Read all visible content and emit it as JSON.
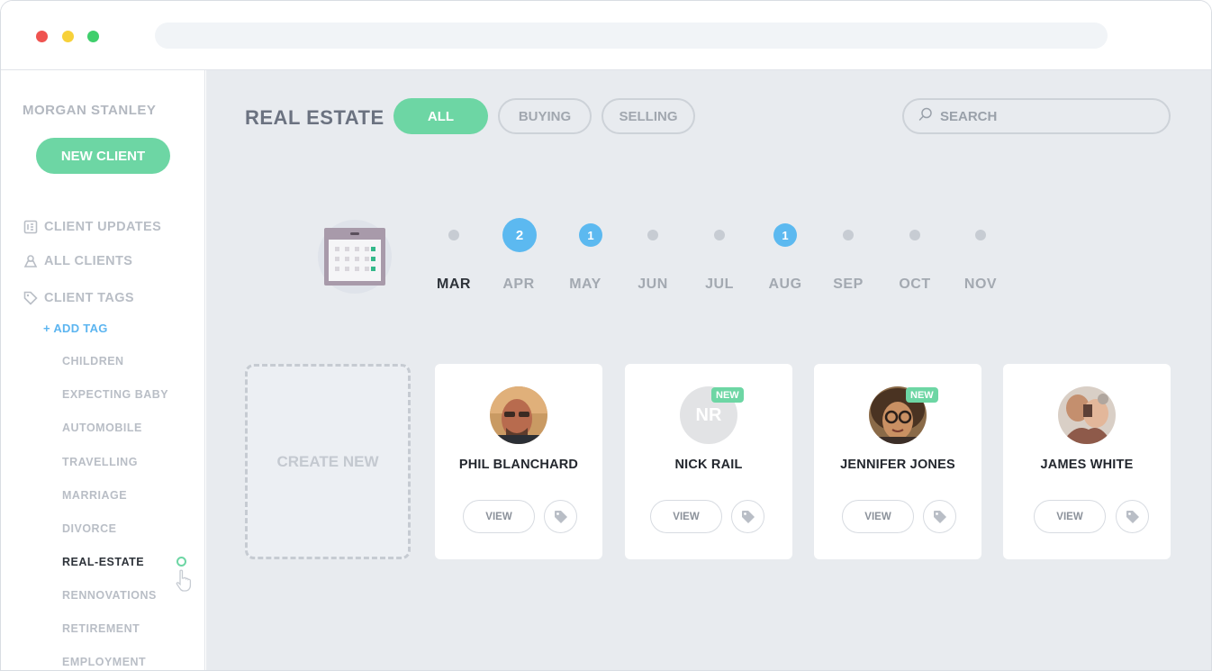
{
  "sidebar": {
    "brand": "MORGAN STANLEY",
    "new_client_label": "NEW CLIENT",
    "nav": {
      "client_updates": "CLIENT UPDATES",
      "all_clients": "ALL CLIENTS",
      "client_tags": "CLIENT TAGS"
    },
    "add_tag_label": "+ ADD TAG",
    "tags": [
      "CHILDREN",
      "EXPECTING BABY",
      "AUTOMOBILE",
      "TRAVELLING",
      "MARRIAGE",
      "DIVORCE",
      "REAL-ESTATE",
      "RENNOVATIONS",
      "RETIREMENT",
      "EMPLOYMENT"
    ],
    "active_tag": "REAL-ESTATE"
  },
  "header": {
    "title": "REAL ESTATE",
    "filters": {
      "all": "ALL",
      "buying": "BUYING",
      "selling": "SELLING"
    },
    "active_filter": "ALL",
    "search_placeholder": "SEARCH"
  },
  "timeline": {
    "months": [
      "MAR",
      "APR",
      "MAY",
      "JUN",
      "JUL",
      "AUG",
      "SEP",
      "OCT",
      "NOV"
    ],
    "current_month": "MAR",
    "counts": {
      "apr": "2",
      "may": "1",
      "aug": "1"
    }
  },
  "cards": {
    "create_new_label": "CREATE NEW",
    "view_label": "VIEW",
    "new_badge": "NEW",
    "clients": [
      {
        "name": "PHIL BLANCHARD"
      },
      {
        "name": "NICK RAIL",
        "initials": "NR"
      },
      {
        "name": "JENNIFER JONES"
      },
      {
        "name": "JAMES WHITE"
      }
    ]
  },
  "colors": {
    "accent_green": "#6dd6a4",
    "accent_blue": "#5cb9f0",
    "main_bg": "#e8ebef"
  }
}
